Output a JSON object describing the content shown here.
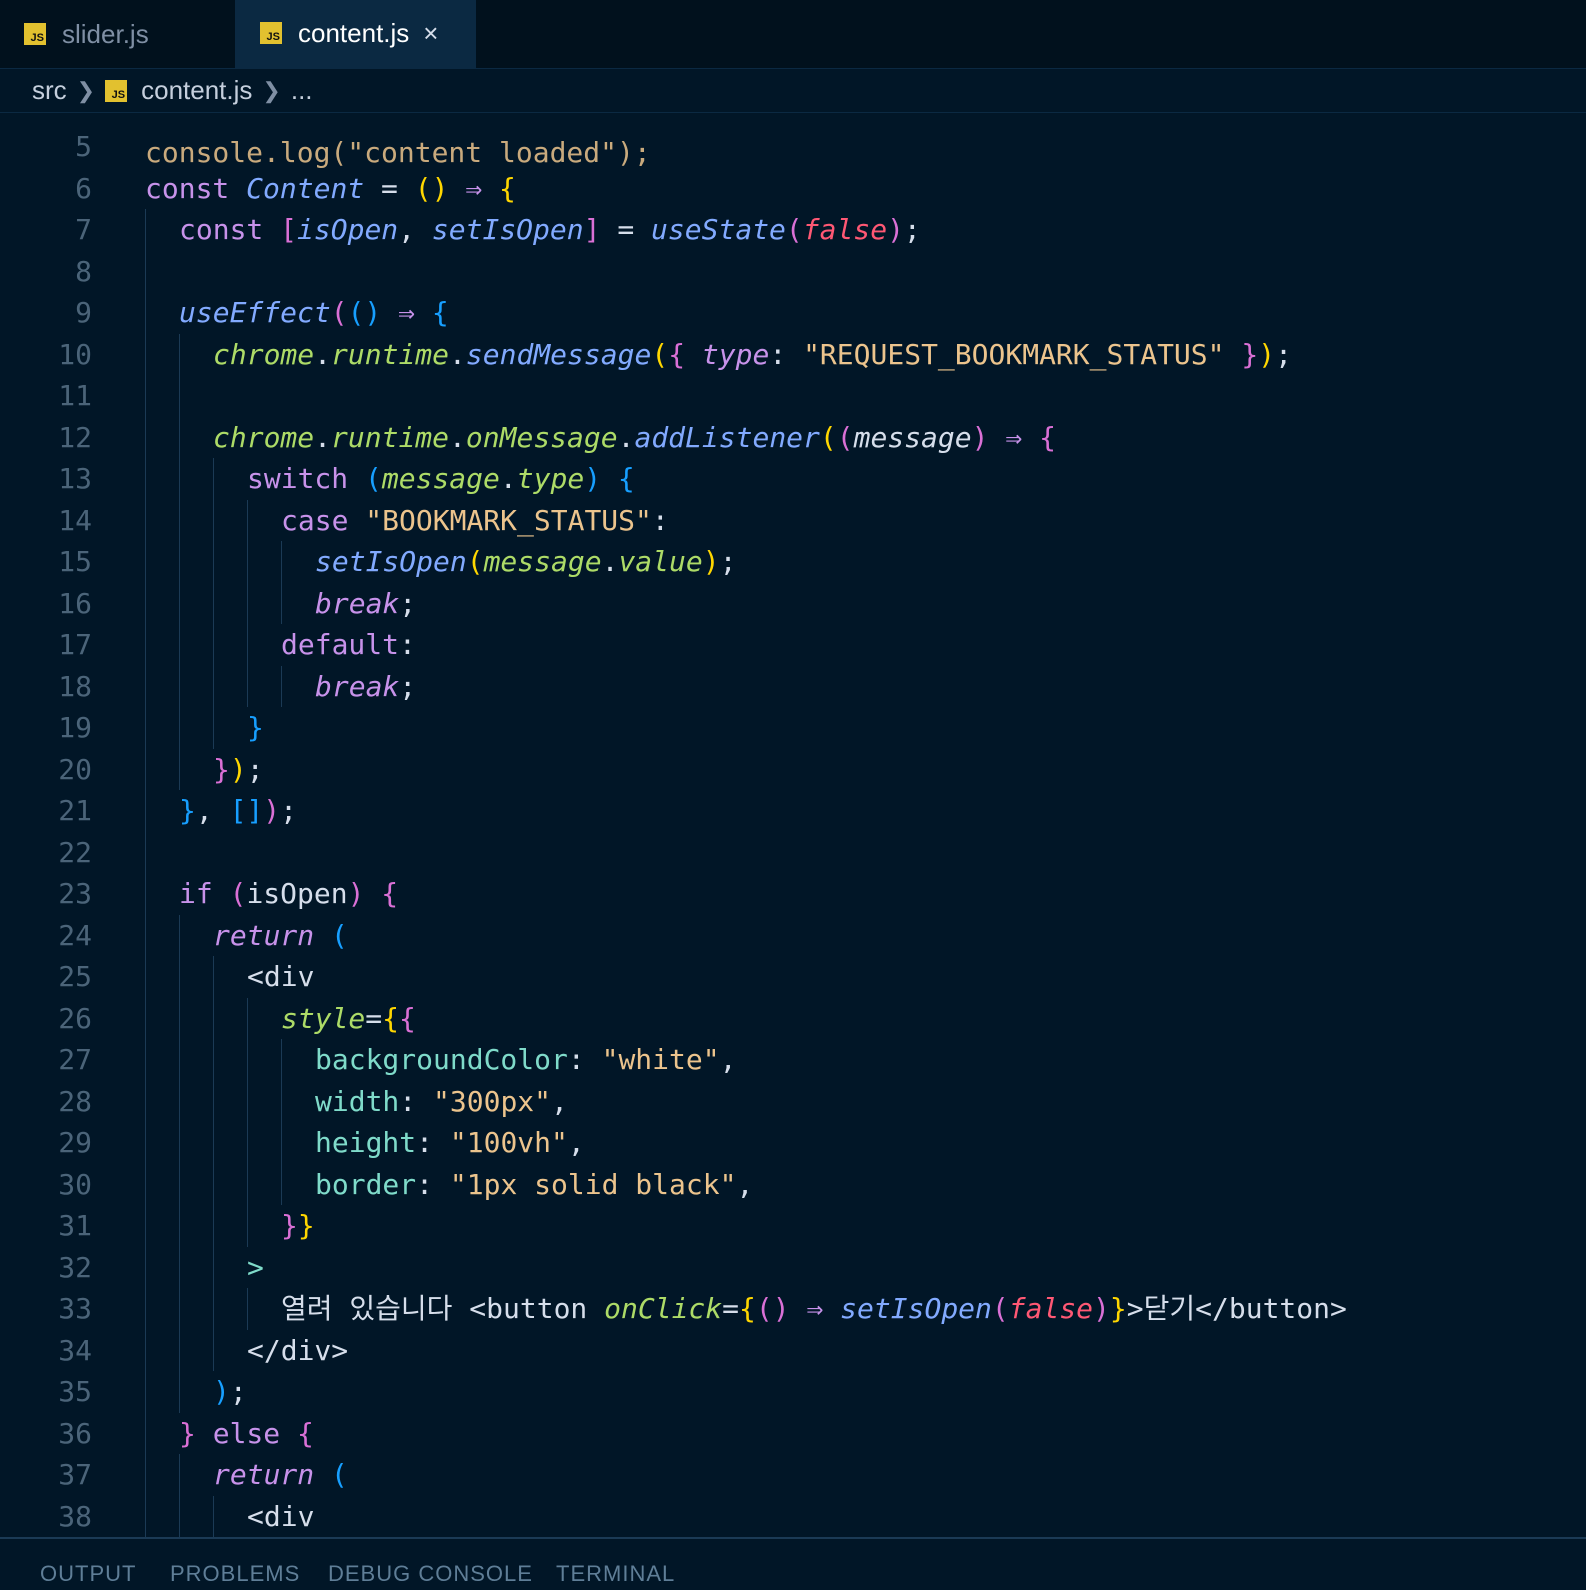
{
  "tabs": [
    {
      "label": "slider.js",
      "icon": "JS",
      "active": false
    },
    {
      "label": "content.js",
      "icon": "JS",
      "active": true,
      "close": "×"
    }
  ],
  "breadcrumb": {
    "folder": "src",
    "file": "content.js",
    "icon": "JS",
    "more": "..."
  },
  "code": {
    "ghost_line": "console.log(\"content loaded\");",
    "lines": [
      {
        "n": "5",
        "indent": 0,
        "t": []
      },
      {
        "n": "6",
        "indent": 0,
        "t": [
          [
            "kw",
            "const "
          ],
          [
            "fn",
            "Content"
          ],
          [
            "plain",
            " = "
          ],
          [
            "b1",
            "()"
          ],
          [
            "kw",
            " ⇒ "
          ],
          [
            "b1",
            "{"
          ]
        ]
      },
      {
        "n": "7",
        "indent": 1,
        "t": [
          [
            "kw",
            "const "
          ],
          [
            "b2",
            "["
          ],
          [
            "fn",
            "isOpen"
          ],
          [
            "plain",
            ", "
          ],
          [
            "fn",
            "setIsOpen"
          ],
          [
            "b2",
            "]"
          ],
          [
            "plain",
            " = "
          ],
          [
            "fn",
            "useState"
          ],
          [
            "b2",
            "("
          ],
          [
            "bool",
            "false"
          ],
          [
            "b2",
            ")"
          ],
          [
            "plain",
            ";"
          ]
        ]
      },
      {
        "n": "8",
        "indent": 1,
        "t": []
      },
      {
        "n": "9",
        "indent": 1,
        "t": [
          [
            "fn",
            "useEffect"
          ],
          [
            "b2",
            "("
          ],
          [
            "b3",
            "()"
          ],
          [
            "kw",
            " ⇒ "
          ],
          [
            "b3",
            "{"
          ]
        ]
      },
      {
        "n": "10",
        "indent": 2,
        "t": [
          [
            "obj",
            "chrome"
          ],
          [
            "plain",
            "."
          ],
          [
            "obj",
            "runtime"
          ],
          [
            "plain",
            "."
          ],
          [
            "fn",
            "sendMessage"
          ],
          [
            "b1",
            "("
          ],
          [
            "b2",
            "{ "
          ],
          [
            "ctl",
            "type"
          ],
          [
            "plain",
            ": "
          ],
          [
            "str",
            "\"REQUEST_BOOKMARK_STATUS\""
          ],
          [
            "b2",
            " }"
          ],
          [
            "b1",
            ")"
          ],
          [
            "plain",
            ";"
          ]
        ]
      },
      {
        "n": "11",
        "indent": 2,
        "t": []
      },
      {
        "n": "12",
        "indent": 2,
        "t": [
          [
            "obj",
            "chrome"
          ],
          [
            "plain",
            "."
          ],
          [
            "obj",
            "runtime"
          ],
          [
            "plain",
            "."
          ],
          [
            "obj",
            "onMessage"
          ],
          [
            "plain",
            "."
          ],
          [
            "fn",
            "addListener"
          ],
          [
            "b1",
            "("
          ],
          [
            "b2",
            "("
          ],
          [
            "var it",
            "message"
          ],
          [
            "b2",
            ")"
          ],
          [
            "kw",
            " ⇒ "
          ],
          [
            "b2",
            "{"
          ]
        ]
      },
      {
        "n": "13",
        "indent": 3,
        "t": [
          [
            "kw",
            "switch "
          ],
          [
            "b3",
            "("
          ],
          [
            "obj",
            "message"
          ],
          [
            "plain",
            "."
          ],
          [
            "obj",
            "type"
          ],
          [
            "b3",
            ")"
          ],
          [
            "b3",
            " {"
          ]
        ]
      },
      {
        "n": "14",
        "indent": 4,
        "t": [
          [
            "kw",
            "case "
          ],
          [
            "str",
            "\"BOOKMARK_STATUS\""
          ],
          [
            "plain",
            ":"
          ]
        ]
      },
      {
        "n": "15",
        "indent": 5,
        "t": [
          [
            "fn",
            "setIsOpen"
          ],
          [
            "b1",
            "("
          ],
          [
            "obj",
            "message"
          ],
          [
            "plain",
            "."
          ],
          [
            "obj",
            "value"
          ],
          [
            "b1",
            ")"
          ],
          [
            "plain",
            ";"
          ]
        ]
      },
      {
        "n": "16",
        "indent": 5,
        "t": [
          [
            "ctl",
            "break"
          ],
          [
            "plain",
            ";"
          ]
        ]
      },
      {
        "n": "17",
        "indent": 4,
        "t": [
          [
            "kw",
            "default"
          ],
          [
            "plain",
            ":"
          ]
        ]
      },
      {
        "n": "18",
        "indent": 5,
        "t": [
          [
            "ctl",
            "break"
          ],
          [
            "plain",
            ";"
          ]
        ]
      },
      {
        "n": "19",
        "indent": 3,
        "t": [
          [
            "b3",
            "}"
          ]
        ]
      },
      {
        "n": "20",
        "indent": 2,
        "t": [
          [
            "b2",
            "}"
          ],
          [
            "b1",
            ")"
          ],
          [
            "plain",
            ";"
          ]
        ]
      },
      {
        "n": "21",
        "indent": 1,
        "t": [
          [
            "b3",
            "}"
          ],
          [
            "plain",
            ", "
          ],
          [
            "b3",
            "[]"
          ],
          [
            "b2",
            ")"
          ],
          [
            "plain",
            ";"
          ]
        ]
      },
      {
        "n": "22",
        "indent": 1,
        "t": []
      },
      {
        "n": "23",
        "indent": 1,
        "t": [
          [
            "kw",
            "if "
          ],
          [
            "b2",
            "("
          ],
          [
            "plain",
            "isOpen"
          ],
          [
            "b2",
            ")"
          ],
          [
            "b2",
            " {"
          ]
        ]
      },
      {
        "n": "24",
        "indent": 2,
        "t": [
          [
            "ctl",
            "return "
          ],
          [
            "b3",
            "("
          ]
        ]
      },
      {
        "n": "25",
        "indent": 3,
        "t": [
          [
            "plain",
            "<div"
          ]
        ]
      },
      {
        "n": "26",
        "indent": 4,
        "t": [
          [
            "obj",
            "style"
          ],
          [
            "plain",
            "="
          ],
          [
            "b1",
            "{"
          ],
          [
            "b2",
            "{"
          ]
        ]
      },
      {
        "n": "27",
        "indent": 5,
        "t": [
          [
            "prop",
            "backgroundColor"
          ],
          [
            "plain",
            ": "
          ],
          [
            "str",
            "\"white\""
          ],
          [
            "plain",
            ","
          ]
        ]
      },
      {
        "n": "28",
        "indent": 5,
        "t": [
          [
            "prop",
            "width"
          ],
          [
            "plain",
            ": "
          ],
          [
            "str",
            "\"300px\""
          ],
          [
            "plain",
            ","
          ]
        ]
      },
      {
        "n": "29",
        "indent": 5,
        "t": [
          [
            "prop",
            "height"
          ],
          [
            "plain",
            ": "
          ],
          [
            "str",
            "\"100vh\""
          ],
          [
            "plain",
            ","
          ]
        ]
      },
      {
        "n": "30",
        "indent": 5,
        "t": [
          [
            "prop",
            "border"
          ],
          [
            "plain",
            ": "
          ],
          [
            "str",
            "\"1px solid black\""
          ],
          [
            "plain",
            ","
          ]
        ]
      },
      {
        "n": "31",
        "indent": 4,
        "t": [
          [
            "b2",
            "}"
          ],
          [
            "b1",
            "}"
          ]
        ]
      },
      {
        "n": "32",
        "indent": 3,
        "t": [
          [
            "tag",
            ">"
          ]
        ]
      },
      {
        "n": "33",
        "indent": 4,
        "t": [
          [
            "plain",
            "열려 있습니다 "
          ],
          [
            "plain",
            "<button "
          ],
          [
            "obj",
            "onClick"
          ],
          [
            "plain",
            "="
          ],
          [
            "b1",
            "{"
          ],
          [
            "b2",
            "()"
          ],
          [
            "kw",
            " ⇒ "
          ],
          [
            "fn",
            "setIsOpen"
          ],
          [
            "b2",
            "("
          ],
          [
            "bool",
            "false"
          ],
          [
            "b2",
            ")"
          ],
          [
            "b1",
            "}"
          ],
          [
            "plain",
            ">닫기</button>"
          ]
        ]
      },
      {
        "n": "34",
        "indent": 3,
        "t": [
          [
            "plain",
            "</div>"
          ]
        ]
      },
      {
        "n": "35",
        "indent": 2,
        "t": [
          [
            "b3",
            ")"
          ],
          [
            "plain",
            ";"
          ]
        ]
      },
      {
        "n": "36",
        "indent": 1,
        "t": [
          [
            "b2",
            "}"
          ],
          [
            "kw",
            " else "
          ],
          [
            "b2",
            "{"
          ]
        ]
      },
      {
        "n": "37",
        "indent": 2,
        "t": [
          [
            "ctl",
            "return "
          ],
          [
            "b3",
            "("
          ]
        ]
      },
      {
        "n": "38",
        "indent": 3,
        "t": [
          [
            "plain",
            "<div"
          ]
        ]
      }
    ]
  },
  "panel": {
    "tabs": [
      "OUTPUT",
      "PROBLEMS",
      "DEBUG CONSOLE",
      "TERMINAL"
    ]
  },
  "colors": {
    "background": "#011627",
    "keyword": "#c792ea",
    "function": "#82aaff",
    "string": "#ecc48d",
    "boolean": "#ff5874",
    "property": "#7fdbca",
    "object": "#addb67"
  }
}
